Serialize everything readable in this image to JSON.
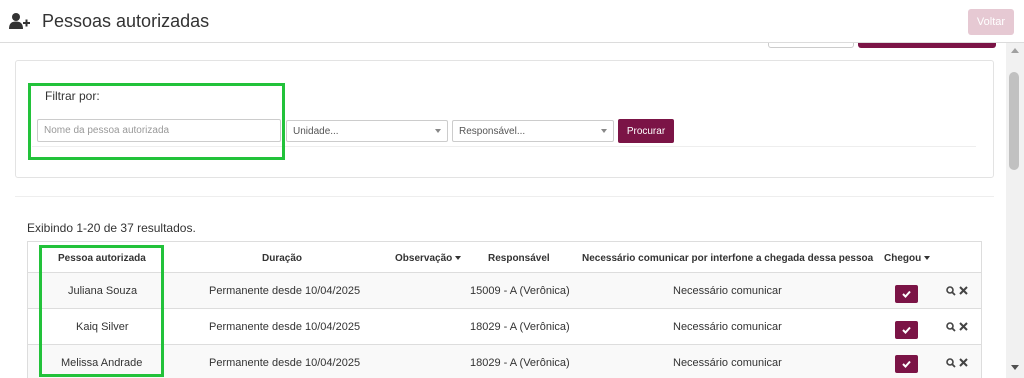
{
  "header": {
    "title": "Pessoas autorizadas",
    "back_label": "Voltar",
    "icon": "user-add-icon"
  },
  "filter": {
    "label": "Filtrar por:",
    "name_placeholder": "Nome da pessoa autorizada",
    "unidade_label": "Unidade...",
    "responsavel_label": "Responsável...",
    "search_label": "Procurar"
  },
  "results": {
    "summary": "Exibindo 1-20 de 37 resultados."
  },
  "table": {
    "headers": {
      "pessoa": "Pessoa autorizada",
      "duracao": "Duração",
      "observacao": "Observação",
      "responsavel": "Responsável",
      "comunicar": "Necessário comunicar por interfone a chegada dessa pessoa",
      "chegou": "Chegou"
    },
    "rows": [
      {
        "pessoa": "Juliana Souza",
        "duracao": "Permanente desde 10/04/2025",
        "observacao": "",
        "responsavel": "15009 - A (Verônica)",
        "comunicar": "Necessário comunicar"
      },
      {
        "pessoa": "Kaiq Silver",
        "duracao": "Permanente desde 10/04/2025",
        "observacao": "",
        "responsavel": "18029 - A (Verônica)",
        "comunicar": "Necessário comunicar"
      },
      {
        "pessoa": "Melissa Andrade",
        "duracao": "Permanente desde 10/04/2025",
        "observacao": "",
        "responsavel": "18029 - A (Verônica)",
        "comunicar": "Necessário comunicar"
      }
    ]
  },
  "colors": {
    "brand": "#7b1446",
    "highlight": "#22c23a",
    "back_button": "#e6c9d3"
  }
}
